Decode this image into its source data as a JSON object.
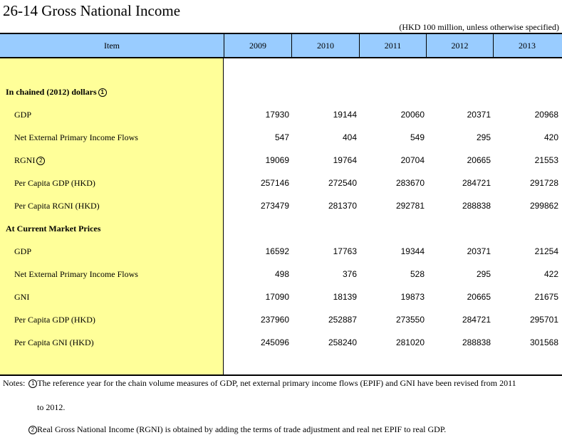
{
  "title": "26-14  Gross National Income",
  "unit": "(HKD 100 million, unless otherwise specified)",
  "header": {
    "item": "Item",
    "years": [
      "2009",
      "2010",
      "2011",
      "2012",
      "2013"
    ]
  },
  "sections": [
    {
      "label": "In chained (2012) dollars",
      "marker": "1",
      "rows": [
        {
          "label": "GDP",
          "values": [
            "17930",
            "19144",
            "20060",
            "20371",
            "20968"
          ]
        },
        {
          "label": "Net External Primary Income Flows",
          "values": [
            "547",
            "404",
            "549",
            "295",
            "420"
          ]
        },
        {
          "label": "RGNI",
          "marker": "2",
          "values": [
            "19069",
            "19764",
            "20704",
            "20665",
            "21553"
          ]
        },
        {
          "label": "Per Capita GDP (HKD)",
          "values": [
            "257146",
            "272540",
            "283670",
            "284721",
            "291728"
          ]
        },
        {
          "label": "Per Capita RGNI (HKD)",
          "values": [
            "273479",
            "281370",
            "292781",
            "288838",
            "299862"
          ]
        }
      ]
    },
    {
      "label": "At Current Market Prices",
      "rows": [
        {
          "label": "GDP",
          "values": [
            "16592",
            "17763",
            "19344",
            "20371",
            "21254"
          ]
        },
        {
          "label": "Net External Primary Income Flows",
          "values": [
            "498",
            "376",
            "528",
            "295",
            "422"
          ]
        },
        {
          "label": "GNI",
          "values": [
            "17090",
            "18139",
            "19873",
            "20665",
            "21675"
          ]
        },
        {
          "label": "Per Capita GDP (HKD)",
          "values": [
            "237960",
            "252887",
            "273550",
            "284721",
            "295701"
          ]
        },
        {
          "label": "Per Capita GNI (HKD)",
          "values": [
            "245096",
            "258240",
            "281020",
            "288838",
            "301568"
          ]
        }
      ]
    }
  ],
  "notes": {
    "prefix": "Notes:",
    "note1_marker": "1",
    "note1_line1": "The reference year for the chain volume measures of GDP, net external primary income flows (EPIF) and GNI have been revised from 2011",
    "note1_line2": "to 2012.",
    "note2_marker": "2",
    "note2": "Real Gross National Income (RGNI) is obtained by adding the terms of trade adjustment and real net EPIF to real GDP."
  },
  "colors": {
    "header_bg": "#99ccff",
    "item_column_bg": "#ffff99"
  }
}
